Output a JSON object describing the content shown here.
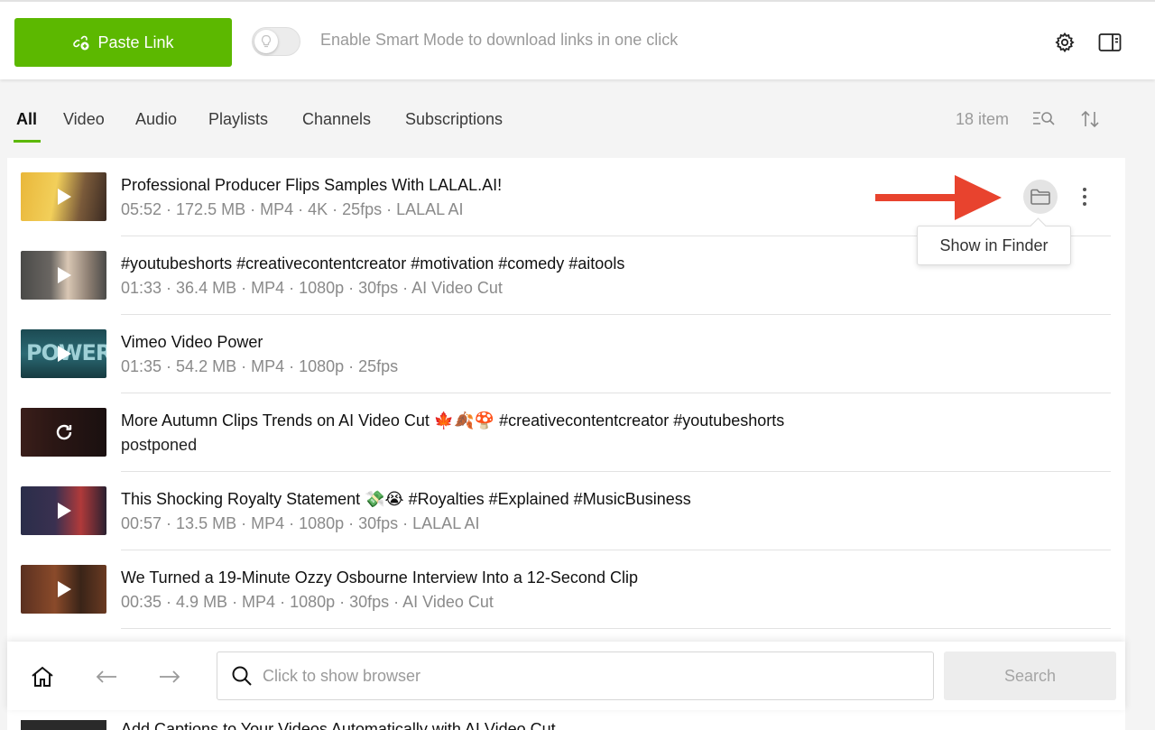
{
  "topbar": {
    "paste_label": "Paste Link",
    "smart_mode_text": "Enable Smart Mode to download links in one click",
    "accent_color": "#5cb800"
  },
  "tabs": [
    {
      "label": "All",
      "active": true
    },
    {
      "label": "Video"
    },
    {
      "label": "Audio"
    },
    {
      "label": "Playlists"
    },
    {
      "label": "Channels"
    },
    {
      "label": "Subscriptions"
    }
  ],
  "item_count": "18 item",
  "items": [
    {
      "title": "Professional Producer Flips Samples With LALAL.AI!",
      "meta": "05:52 · 172.5 MB · MP4 · 4K · 25fps · LALAL AI",
      "thumb_icon": "play-icon"
    },
    {
      "title": "#youtubeshorts #creativecontentcreator #motivation #comedy #aitools",
      "meta": "01:33 · 36.4 MB · MP4 · 1080p · 30fps · AI Video Cut",
      "thumb_icon": "play-icon"
    },
    {
      "title": "Vimeo   Video Power",
      "meta": "01:35 · 54.2 MB · MP4 · 1080p · 25fps",
      "thumb_icon": "play-icon",
      "thumb_text": "POWER"
    },
    {
      "title": "More Autumn Clips Trends on AI Video Cut 🍁🍂🍄 #creativecontentcreator #youtubeshorts",
      "meta": "postponed",
      "thumb_icon": "retry-icon"
    },
    {
      "title": "This Shocking Royalty Statement 💸😭 #Royalties #Explained #MusicBusiness",
      "meta": "00:57 · 13.5 MB · MP4 · 1080p · 30fps · LALAL AI",
      "thumb_icon": "play-icon"
    },
    {
      "title": "We Turned a 19-Minute Ozzy Osbourne Interview Into a 12-Second Clip",
      "meta": "00:35 · 4.9 MB · MP4 · 1080p · 30fps · AI Video Cut",
      "thumb_icon": "play-icon"
    }
  ],
  "peek_item": {
    "title": "Add Captions to Your Videos Automatically with AI Video Cut"
  },
  "tooltip": "Show in Finder",
  "browser": {
    "placeholder": "Click to show browser",
    "search_label": "Search"
  }
}
